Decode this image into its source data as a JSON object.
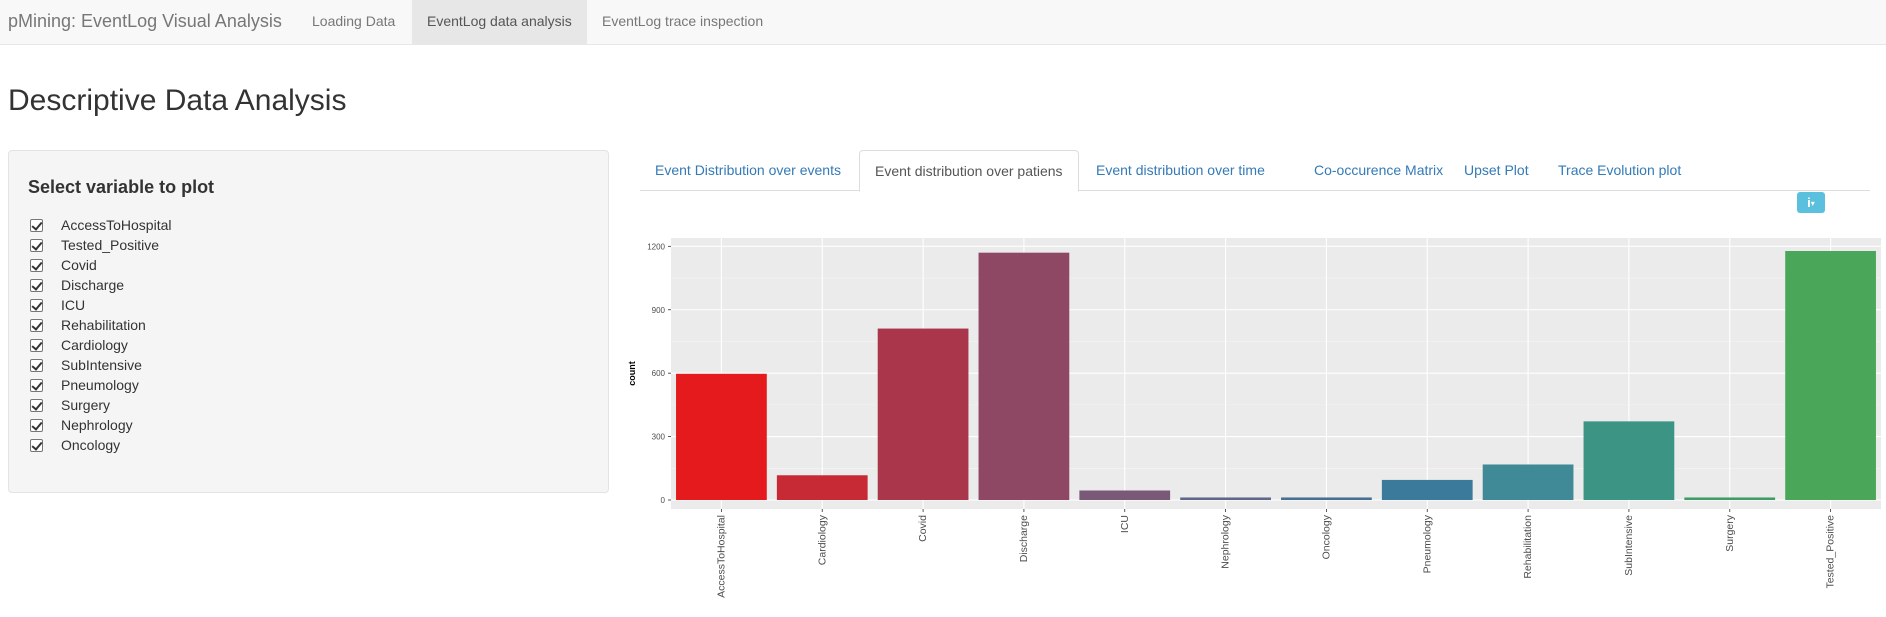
{
  "navbar": {
    "brand": "pMining: EventLog Visual Analysis",
    "items": [
      {
        "label": "Loading Data",
        "active": false
      },
      {
        "label": "EventLog data analysis",
        "active": true
      },
      {
        "label": "EventLog trace inspection",
        "active": false
      }
    ]
  },
  "page": {
    "title": "Descriptive Data Analysis"
  },
  "sidebar": {
    "title": "Select variable to plot",
    "variables": [
      {
        "label": "AccessToHospital",
        "checked": true
      },
      {
        "label": "Tested_Positive",
        "checked": true
      },
      {
        "label": "Covid",
        "checked": true
      },
      {
        "label": "Discharge",
        "checked": true
      },
      {
        "label": "ICU",
        "checked": true
      },
      {
        "label": "Rehabilitation",
        "checked": true
      },
      {
        "label": "Cardiology",
        "checked": true
      },
      {
        "label": "SubIntensive",
        "checked": true
      },
      {
        "label": "Pneumology",
        "checked": true
      },
      {
        "label": "Surgery",
        "checked": true
      },
      {
        "label": "Nephrology",
        "checked": true
      },
      {
        "label": "Oncology",
        "checked": true
      }
    ]
  },
  "tabs": [
    {
      "label": "Event Distribution over events",
      "active": false
    },
    {
      "label": "Event distribution over patiens",
      "active": true
    },
    {
      "label": "Event distribution over time",
      "active": false
    },
    {
      "label": "Co-occurence Matrix",
      "active": false
    },
    {
      "label": "Upset Plot",
      "active": false
    },
    {
      "label": "Trace Evolution plot",
      "active": false
    }
  ],
  "info_button": {
    "icon": "info-icon",
    "caret": "▾",
    "glyph": "i"
  },
  "chart_data": {
    "type": "bar",
    "title": "",
    "xlabel": "",
    "ylabel": "count",
    "ylim": [
      0,
      1230
    ],
    "yticks": [
      0,
      300,
      600,
      900,
      1200
    ],
    "grid": true,
    "legend": "none",
    "categories": [
      "AccessToHospital",
      "Cardiology",
      "Covid",
      "Discharge",
      "ICU",
      "Nephrology",
      "Oncology",
      "Pneumology",
      "Rehabilitation",
      "SubIntensive",
      "Surgery",
      "Tested_Positive"
    ],
    "values": [
      597,
      117,
      811,
      1170,
      45,
      12,
      12,
      95,
      168,
      372,
      12,
      1178
    ],
    "colors": [
      "#e41a1c",
      "#c72a35",
      "#a9364a",
      "#8e4863",
      "#7a5878",
      "#5f6788",
      "#476f92",
      "#3b7a9a",
      "#3f8a96",
      "#3c9584",
      "#3f9c66",
      "#4aa75a"
    ],
    "panel_bg": "#ebebeb"
  }
}
